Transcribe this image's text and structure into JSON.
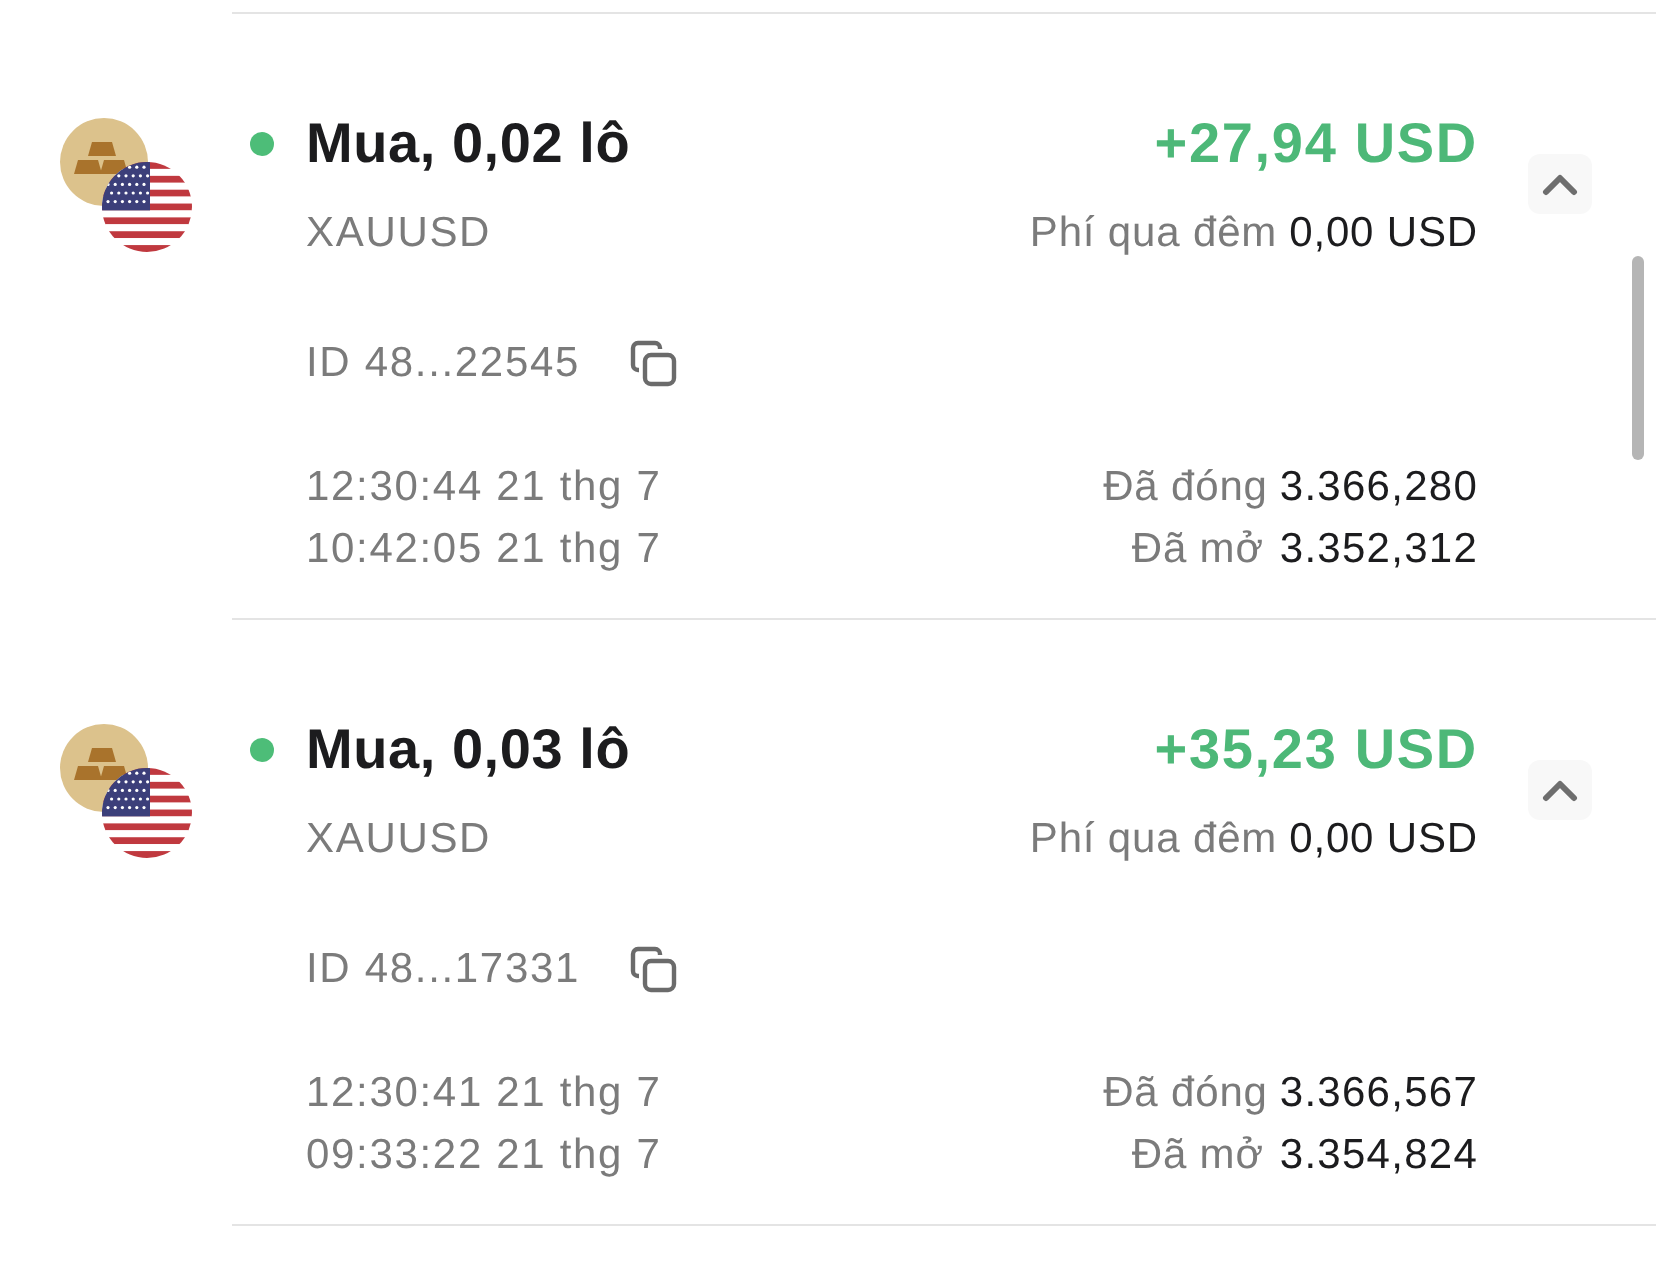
{
  "trades": [
    {
      "title": "Mua, 0,02 lô",
      "profit": "+27,94 USD",
      "symbol": "XAUUSD",
      "swap_label": "Phí qua đêm",
      "swap_value": "0,00 USD",
      "id": "ID 48...22545",
      "closed_time": "12:30:44 21 thg 7",
      "closed_label": "Đã đóng",
      "closed_price": "3.366,280",
      "opened_time": "10:42:05 21 thg 7",
      "opened_label": "Đã mở",
      "opened_price": "3.352,312",
      "expanded": true
    },
    {
      "title": "Mua, 0,03 lô",
      "profit": "+35,23 USD",
      "symbol": "XAUUSD",
      "swap_label": "Phí qua đêm",
      "swap_value": "0,00 USD",
      "id": "ID 48...17331",
      "closed_time": "12:30:41 21 thg 7",
      "closed_label": "Đã đóng",
      "closed_price": "3.366,567",
      "opened_time": "09:33:22 21 thg 7",
      "opened_label": "Đã mở",
      "opened_price": "3.354,824",
      "expanded": true
    }
  ]
}
